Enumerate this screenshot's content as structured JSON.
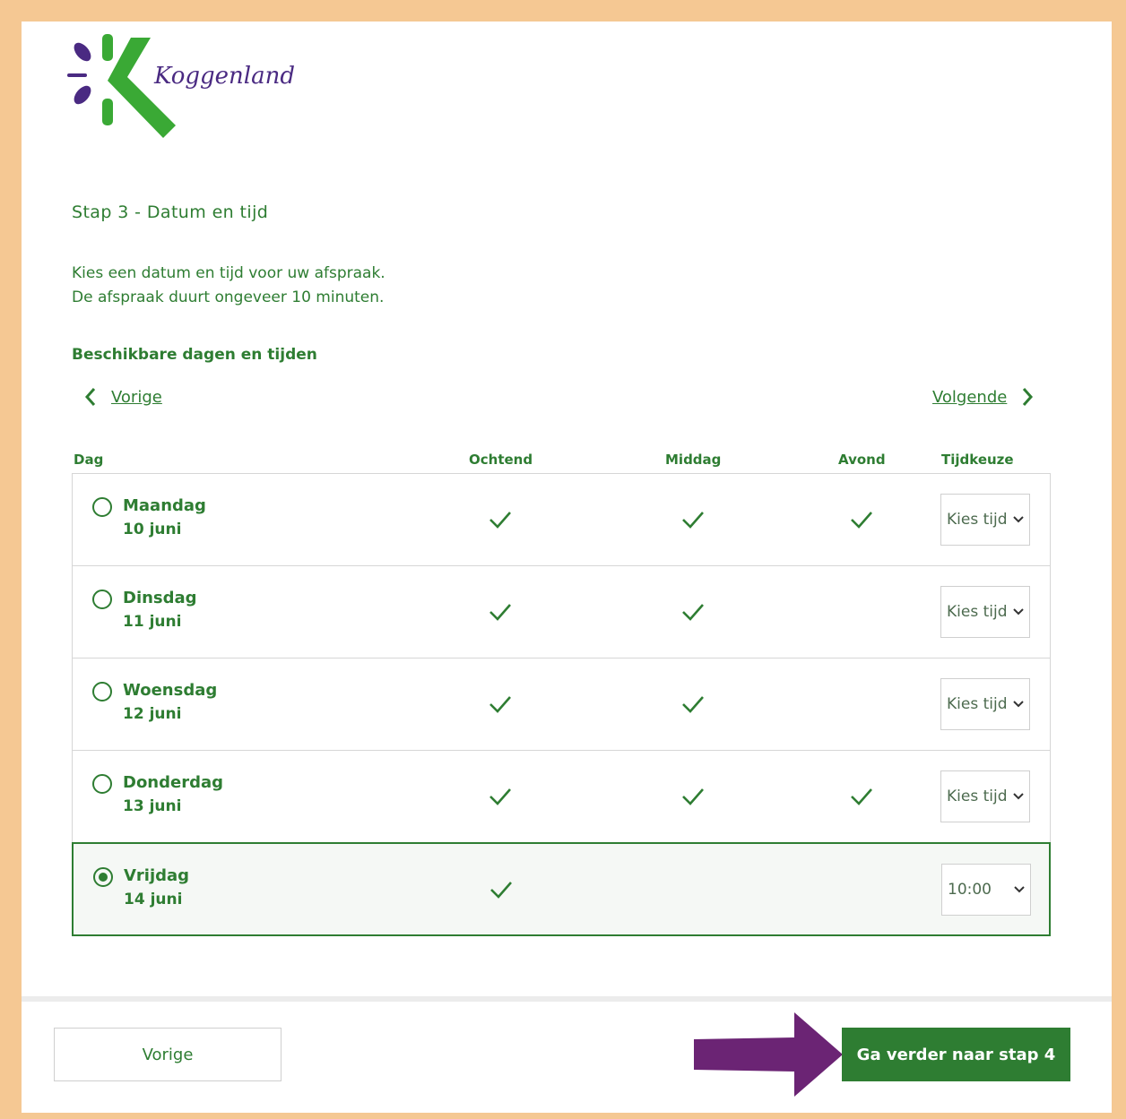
{
  "brand": {
    "name": "Koggenland",
    "green": "#2e7d32",
    "logo_green": "#3aa935",
    "logo_purple": "#4a2a82"
  },
  "step_title": "Stap 3 - Datum en tijd",
  "intro": {
    "line1": "Kies een datum en tijd voor uw afspraak.",
    "line2": "De afspraak duurt ongeveer 10 minuten."
  },
  "available_heading": "Beschikbare dagen en tijden",
  "nav": {
    "prev_label": "Vorige",
    "next_label": "Volgende"
  },
  "columns": {
    "day": "Dag",
    "morning": "Ochtend",
    "afternoon": "Middag",
    "evening": "Avond",
    "time_choice": "Tijdkeuze"
  },
  "rows": [
    {
      "day": "Maandag",
      "date": "10 juni",
      "morning": true,
      "afternoon": true,
      "evening": true,
      "time": "Kies tijd",
      "selected": false
    },
    {
      "day": "Dinsdag",
      "date": "11 juni",
      "morning": true,
      "afternoon": true,
      "evening": false,
      "time": "Kies tijd",
      "selected": false
    },
    {
      "day": "Woensdag",
      "date": "12 juni",
      "morning": true,
      "afternoon": true,
      "evening": false,
      "time": "Kies tijd",
      "selected": false
    },
    {
      "day": "Donderdag",
      "date": "13 juni",
      "morning": true,
      "afternoon": true,
      "evening": true,
      "time": "Kies tijd",
      "selected": false
    },
    {
      "day": "Vrijdag",
      "date": "14 juni",
      "morning": true,
      "afternoon": false,
      "evening": false,
      "time": "10:00",
      "selected": true
    }
  ],
  "footer": {
    "prev_button": "Vorige",
    "next_button": "Ga verder naar stap 4"
  },
  "annotation": {
    "arrow_color": "#6b2474",
    "arrow_icon": "arrow-right-icon"
  }
}
